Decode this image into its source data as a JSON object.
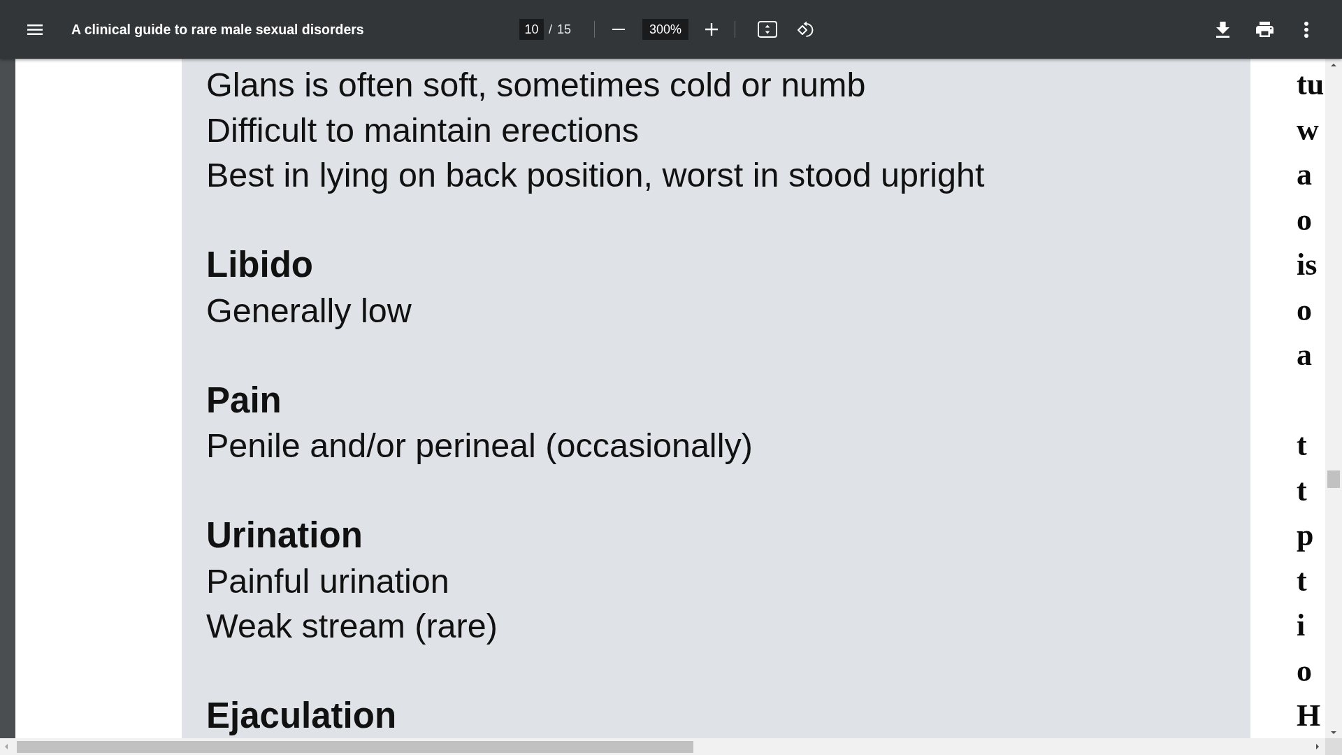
{
  "toolbar": {
    "title": "A clinical guide to rare male sexual disorders",
    "page_number": "10",
    "page_count": "/ 15",
    "zoom": "300%"
  },
  "callout": {
    "sections": [
      {
        "lines": [
          "Glans is often soft, sometimes cold or numb",
          "Difficult to maintain erections",
          "Best in lying on back position, worst in stood upright"
        ]
      },
      {
        "heading": "Libido",
        "lines": [
          "Generally low"
        ]
      },
      {
        "heading": "Pain",
        "lines": [
          "Penile and/or perineal (occasionally)"
        ]
      },
      {
        "heading": "Urination",
        "lines": [
          "Painful urination",
          "Weak stream (rare)"
        ]
      },
      {
        "heading": "Ejaculation"
      }
    ]
  },
  "side_column": {
    "paragraphs": [
      {
        "lines": [
          "tu",
          "w",
          "a",
          "o",
          "is",
          "o",
          "a"
        ]
      },
      {
        "lines": [
          "t",
          "t",
          "p",
          "t",
          "i",
          "o",
          "H"
        ]
      }
    ]
  }
}
